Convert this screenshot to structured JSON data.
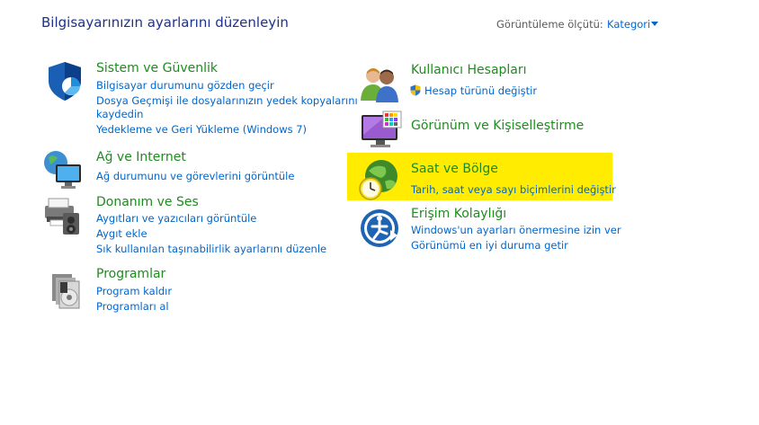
{
  "header": {
    "title": "Bilgisayarınızın ayarlarını düzenleyin",
    "view_by_label": "Görüntüleme ölçütü:",
    "view_by_value": "Kategori"
  },
  "categories": {
    "system_security": {
      "title": "Sistem ve Güvenlik",
      "links": [
        "Bilgisayar durumunu gözden geçir",
        "Dosya Geçmişi ile dosyalarınızın yedek kopyalarını",
        "kaydedin",
        "Yedekleme ve Geri Yükleme (Windows 7)"
      ]
    },
    "network": {
      "title": "Ağ ve Internet",
      "links": [
        "Ağ durumunu ve görevlerini görüntüle"
      ]
    },
    "hardware": {
      "title": "Donanım ve Ses",
      "links": [
        "Aygıtları ve yazıcıları görüntüle",
        "Aygıt ekle",
        "Sık kullanılan taşınabilirlik ayarlarını düzenle"
      ]
    },
    "programs": {
      "title": "Programlar",
      "links": [
        "Program kaldır",
        "Programları al"
      ]
    },
    "user_accounts": {
      "title": "Kullanıcı Hesapları",
      "links": [
        "Hesap türünü değiştir"
      ]
    },
    "appearance": {
      "title": "Görünüm ve Kişiselleştirme",
      "links": []
    },
    "clock_region": {
      "title": "Saat ve Bölge",
      "links": [
        "Tarih, saat veya sayı biçimlerini değiştir"
      ],
      "highlight_color": "#ffec00"
    },
    "ease_of_access": {
      "title": "Erişim Kolaylığı",
      "links": [
        "Windows'un ayarları önermesine izin ver",
        "Görünümü en iyi duruma getir"
      ]
    }
  },
  "colors": {
    "title": "#1e3287",
    "heading": "#1e8c1e",
    "link": "#0066cc",
    "highlight": "#ffec00"
  },
  "icons": [
    "shield-icon",
    "network-icon",
    "printer-icon",
    "programs-icon",
    "users-icon",
    "monitor-icon",
    "globe-clock-icon",
    "ease-of-access-icon",
    "uac-shield-icon"
  ]
}
